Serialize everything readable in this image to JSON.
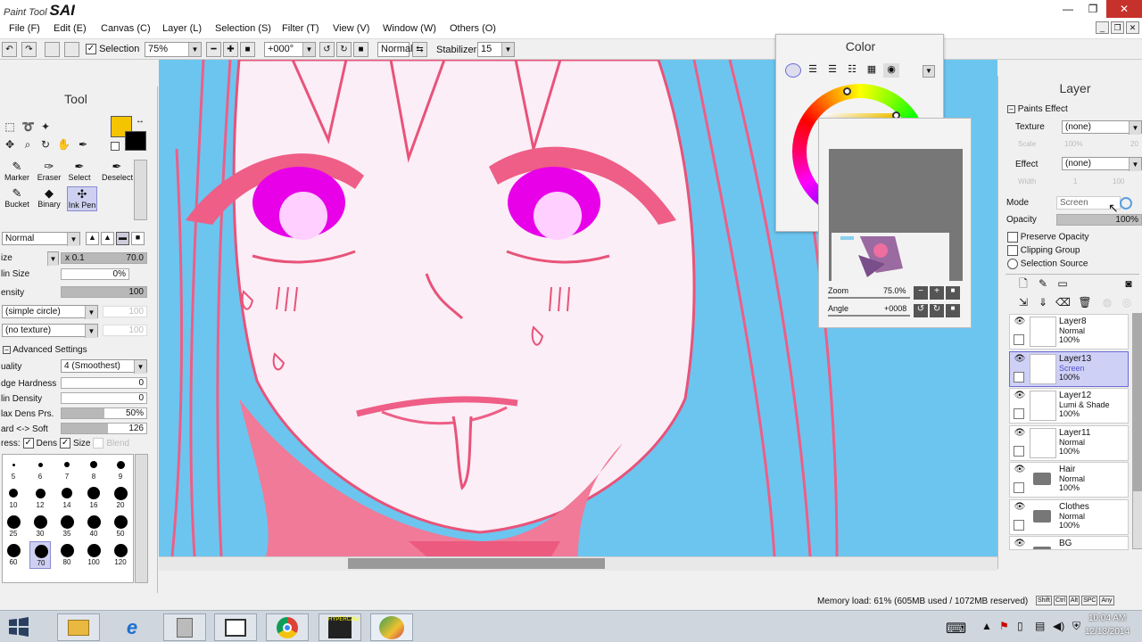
{
  "app": {
    "brand_small": "Paint Tool",
    "brand_big": "SAI"
  },
  "window_controls": {
    "minimize": "—",
    "restore": "❐",
    "close": "✕"
  },
  "menu": [
    "File (F)",
    "Edit (E)",
    "Canvas (C)",
    "Layer (L)",
    "Selection (S)",
    "Filter (T)",
    "View (V)",
    "Window (W)",
    "Others (O)"
  ],
  "toolbar": {
    "selection_label": "Selection",
    "zoom_value": "75%",
    "angle_value": "+000°",
    "blend_value": "Normal",
    "stabilizer_label": "Stabilizer",
    "stabilizer_value": "15"
  },
  "tool_panel": {
    "title": "Tool",
    "primary_color": "#f5c400",
    "secondary_color": "#000000",
    "brushes": [
      {
        "label": "Marker",
        "icon": "marker-icon"
      },
      {
        "label": "Eraser",
        "icon": "eraser-icon"
      },
      {
        "label": "Select",
        "icon": "select-pen-icon"
      },
      {
        "label": "Deselect",
        "icon": "deselect-icon"
      },
      {
        "label": "Bucket",
        "icon": "bucket-icon"
      },
      {
        "label": "Binary",
        "icon": "binary-icon"
      },
      {
        "label": "Ink Pen",
        "icon": "ink-pen-icon"
      }
    ],
    "selected_brush": "Ink Pen",
    "blend_mode": "Normal",
    "size_label": "ize",
    "size_multiplier": "x 0.1",
    "size_value": "70.0",
    "min_size_label": "lin Size",
    "min_size_value": "0%",
    "density_label": "ensity",
    "density_value": "100",
    "density_fraction": 1.0,
    "shape_value": "(simple circle)",
    "shape_strength": "100",
    "texture_value": "(no texture)",
    "texture_strength": "100",
    "advanced_label": "Advanced Settings",
    "quality_label": "uality",
    "quality_value": "4 (Smoothest)",
    "edge_hardness_label": "dge Hardness",
    "edge_hardness_value": "0",
    "min_density_label": "lin Density",
    "min_density_value": "0",
    "max_dens_label": "lax Dens Prs.",
    "max_dens_value": "50%",
    "max_dens_fraction": 0.5,
    "hard_soft_label": "ard <-> Soft",
    "hard_soft_value": "126",
    "hard_soft_fraction": 0.55,
    "press_label": "ress:",
    "press_dens": "Dens",
    "press_size": "Size",
    "press_blend": "Blend",
    "brush_sizes": [
      "5",
      "6",
      "7",
      "8",
      "9",
      "10",
      "12",
      "14",
      "16",
      "20",
      "25",
      "30",
      "35",
      "40",
      "50",
      "60",
      "70",
      "80",
      "100",
      "120"
    ],
    "selected_size": "70"
  },
  "color_panel": {
    "title": "Color"
  },
  "navigator": {
    "zoom_label": "Zoom",
    "zoom_value": "75.0%",
    "angle_label": "Angle",
    "angle_value": "+0008"
  },
  "layer_panel": {
    "title": "Layer",
    "paints_effect_label": "Paints Effect",
    "texture_label": "Texture",
    "texture_value": "(none)",
    "scale_label": "Scale",
    "scale_value": "100%",
    "scale_extra": "20",
    "effect_label": "Effect",
    "effect_value": "(none)",
    "width_label": "Width",
    "width_value": "1",
    "width_extra": "100",
    "mode_label": "Mode",
    "mode_value": "Screen",
    "opacity_label": "Opacity",
    "opacity_value": "100%",
    "preserve_opacity": "Preserve Opacity",
    "clipping_group": "Clipping Group",
    "selection_source": "Selection Source",
    "layers": [
      {
        "name": "Layer8",
        "mode": "Normal",
        "opacity": "100%",
        "type": "layer",
        "active": false
      },
      {
        "name": "Layer13",
        "mode": "Screen",
        "opacity": "100%",
        "type": "layer",
        "active": true
      },
      {
        "name": "Layer12",
        "mode": "Lumi & Shade",
        "opacity": "100%",
        "type": "layer",
        "active": false
      },
      {
        "name": "Layer11",
        "mode": "Normal",
        "opacity": "100%",
        "type": "layer",
        "active": false
      },
      {
        "name": "Hair",
        "mode": "Normal",
        "opacity": "100%",
        "type": "folder",
        "active": false
      },
      {
        "name": "Clothes",
        "mode": "Normal",
        "opacity": "100%",
        "type": "folder",
        "active": false
      },
      {
        "name": "BG",
        "mode": "",
        "opacity": "",
        "type": "folder",
        "active": false
      }
    ]
  },
  "status": {
    "memory": "Memory load: 61% (605MB used / 1072MB reserved)",
    "keys": [
      "Shift",
      "Ctrl",
      "Alt",
      "SPC",
      "Any"
    ]
  },
  "taskbar": {
    "apps": [
      "start",
      "file-explorer",
      "internet-explorer",
      "notepad",
      "window",
      "chrome",
      "hypercam",
      "paint-tool-sai"
    ],
    "app_labels": {
      "hypercam": "HYPERCAM"
    },
    "time": "10:04 AM",
    "date": "12/13/2014"
  }
}
